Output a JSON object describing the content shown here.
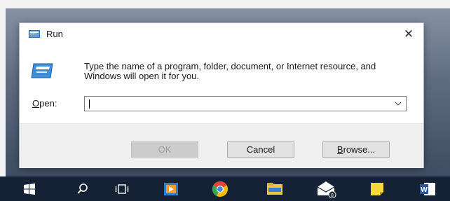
{
  "dialog": {
    "title": "Run",
    "close_glyph": "✕",
    "description": "Type the name of a program, folder, document, or Internet resource, and Windows will open it for you.",
    "open_label_mnemonic": "O",
    "open_label_rest": "pen:",
    "open_value": "",
    "buttons": {
      "ok": "OK",
      "cancel": "Cancel",
      "browse_mnemonic": "B",
      "browse_rest": "rowse..."
    }
  },
  "taskbar": {
    "items": [
      {
        "name": "start-button",
        "icon": "windows-logo"
      },
      {
        "name": "search-button",
        "icon": "search-icon"
      },
      {
        "name": "task-view-button",
        "icon": "task-view-icon"
      },
      {
        "name": "media-app",
        "icon": "media-player-icon"
      },
      {
        "name": "chrome-app",
        "icon": "chrome-icon"
      },
      {
        "name": "file-explorer-app",
        "icon": "folder-icon"
      },
      {
        "name": "mail-app",
        "icon": "mail-icon",
        "badge": "8"
      },
      {
        "name": "sticky-notes-app",
        "icon": "sticky-notes-icon"
      },
      {
        "name": "word-app",
        "icon": "word-icon"
      }
    ]
  },
  "colors": {
    "taskbar": "#152134",
    "accent": "#1e7bd6",
    "dialog_border": "#a9b4c2"
  }
}
